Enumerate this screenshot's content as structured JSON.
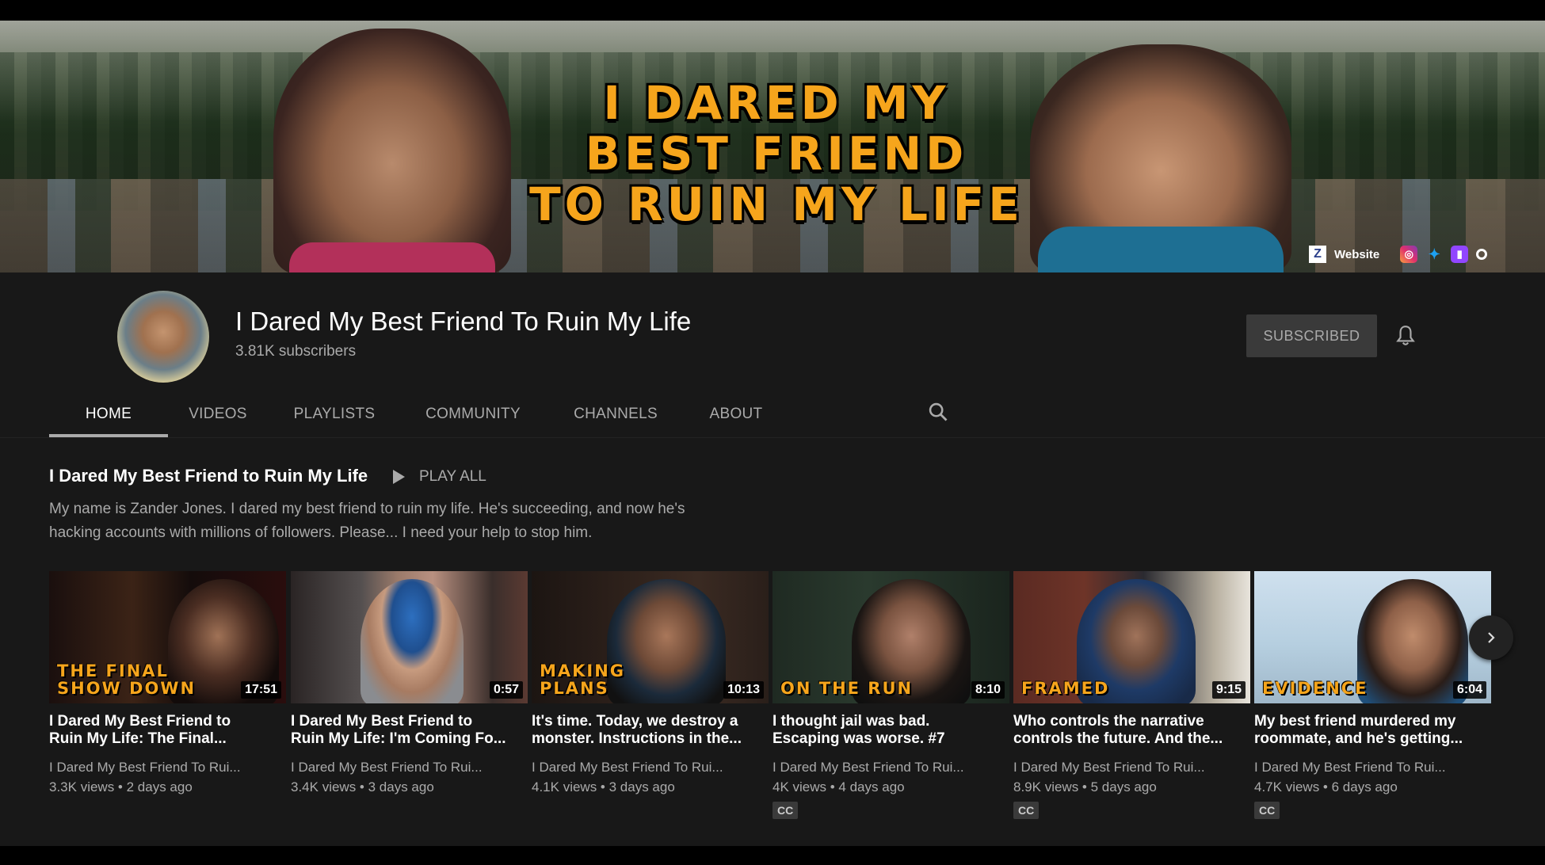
{
  "banner": {
    "title_lines": [
      "I DARED MY",
      "BEST FRIEND",
      "TO RUIN MY LIFE"
    ],
    "link_label": "Website",
    "icons": [
      "website-logo-icon",
      "instagram-icon",
      "twitter-icon",
      "twitch-icon",
      "other-link-icon"
    ]
  },
  "channel": {
    "title": "I Dared My Best Friend To Ruin My Life",
    "subscribers": "3.81K subscribers",
    "subscribe_label": "SUBSCRIBED"
  },
  "tabs": [
    {
      "label": "HOME",
      "active": true
    },
    {
      "label": "VIDEOS"
    },
    {
      "label": "PLAYLISTS"
    },
    {
      "label": "COMMUNITY"
    },
    {
      "label": "CHANNELS"
    },
    {
      "label": "ABOUT"
    }
  ],
  "shelf": {
    "title": "I Dared My Best Friend to Ruin My Life",
    "play_all": "PLAY ALL",
    "description_line1": "My name is Zander Jones. I dared my best friend to ruin my life. He's succeeding, and now he's",
    "description_line2": "hacking accounts with millions of followers. Please... I need your help to stop him."
  },
  "videos": [
    {
      "caption1": "THE FINAL",
      "caption2": "SHOW DOWN",
      "duration": "17:51",
      "title_line1": "I Dared My Best Friend to",
      "title_line2": "Ruin My Life: The Final...",
      "channel": "I Dared My Best Friend To Rui...",
      "meta": "3.3K views • 2 days ago",
      "cc": ""
    },
    {
      "caption1": "",
      "caption2": "",
      "duration": "0:57",
      "title_line1": "I Dared My Best Friend to",
      "title_line2": "Ruin My Life: I'm Coming Fo...",
      "channel": "I Dared My Best Friend To Rui...",
      "meta": "3.4K views • 3 days ago",
      "cc": ""
    },
    {
      "caption1": "MAKING",
      "caption2": "PLANS",
      "duration": "10:13",
      "title_line1": "It's time. Today, we destroy a",
      "title_line2": "monster. Instructions in the...",
      "channel": "I Dared My Best Friend To Rui...",
      "meta": "4.1K views • 3 days ago",
      "cc": ""
    },
    {
      "caption1": "",
      "caption2": "ON THE RUN",
      "duration": "8:10",
      "title_line1": "I thought jail was bad.",
      "title_line2": "Escaping was worse. #7",
      "channel": "I Dared My Best Friend To Rui...",
      "meta": "4K views • 4 days ago",
      "cc": "CC"
    },
    {
      "caption1": "",
      "caption2": "FRAMED",
      "duration": "9:15",
      "title_line1": "Who controls the narrative",
      "title_line2": "controls the future. And the...",
      "channel": "I Dared My Best Friend To Rui...",
      "meta": "8.9K views • 5 days ago",
      "cc": "CC"
    },
    {
      "caption1": "",
      "caption2": "EVIDENCE",
      "duration": "6:04",
      "title_line1": "My best friend murdered my",
      "title_line2": "roommate, and he's getting...",
      "channel": "I Dared My Best Friend To Rui...",
      "meta": "4.7K views • 6 days ago",
      "cc": "CC"
    }
  ],
  "colors": {
    "background": "#181818",
    "accent_text": "#f6a51c",
    "muted_text": "#aaaaaa"
  }
}
